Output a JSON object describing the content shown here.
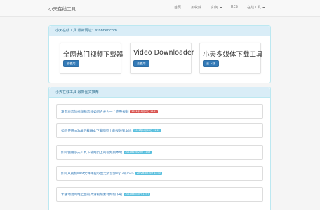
{
  "navbar": {
    "brand": "小天在线工具",
    "items": [
      {
        "label": "首页",
        "dropdown": false
      },
      {
        "label": "加收藏",
        "dropdown": false
      },
      {
        "label": "如何",
        "dropdown": true
      },
      {
        "label": "RES",
        "dropdown": false
      },
      {
        "label": "在线工具",
        "dropdown": true
      }
    ]
  },
  "panel1": {
    "heading": "小天在线工具 最新网址：xtonner.com",
    "cards": [
      {
        "title": "全网热门视频下载器",
        "button": "去使用"
      },
      {
        "title": "Video Downloader",
        "button": "去使用"
      },
      {
        "title": "小天多媒体下载工具",
        "button": "去下载"
      }
    ]
  },
  "panel2": {
    "heading": "小天在线工具 最新图文推荐",
    "items": [
      {
        "title": "没有声音的视频和音频如何合并为一个完整视频",
        "badge": "2022年11月15日 16:41",
        "badge_color": "#d9534f"
      },
      {
        "title": "如何使用m3u8下载器本下载网页上的视频到本地",
        "badge": "2022年10月25日 11:12",
        "badge_color": "#5bc0de"
      },
      {
        "title": "如何使用小天工具下载网页上的视频到本地",
        "badge": "2022年10月23日 11:03",
        "badge_color": "#5bc0de"
      },
      {
        "title": "如何从视频MP4文件中提取出无损音频mp3或m4a",
        "badge": "2022年8月30日 14:30",
        "badge_color": "#5bc0de"
      },
      {
        "title": "卡通动漫网站上面的高清视频素材如何下载",
        "badge": "2022年8月30日 17:07",
        "badge_color": "#5bc0de"
      }
    ]
  },
  "colors": {
    "primary": "#337ab7",
    "info_bg": "#d9edf7",
    "info_text": "#31708f",
    "danger": "#d9534f",
    "info": "#5bc0de"
  }
}
